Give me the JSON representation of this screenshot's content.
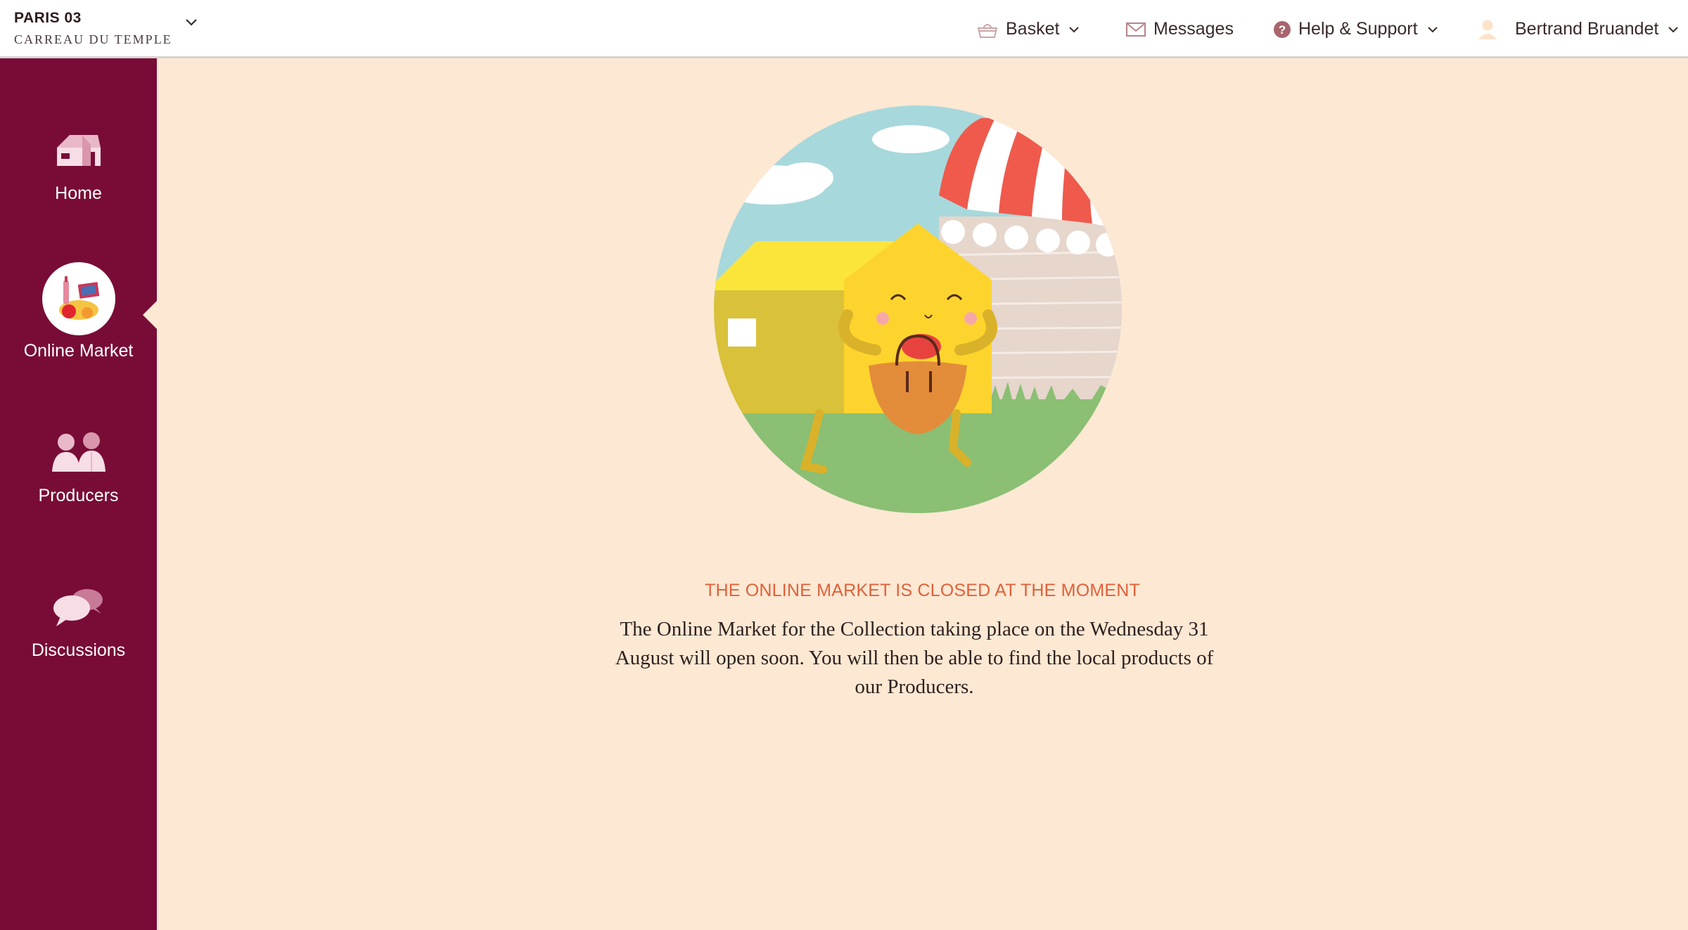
{
  "header": {
    "brand_city": "PARIS 03",
    "brand_sub": "CARREAU DU TEMPLE",
    "nav": {
      "basket": "Basket",
      "messages": "Messages",
      "help": "Help & Support",
      "user": "Bertrand Bruandet"
    }
  },
  "sidebar": {
    "items": [
      {
        "label": "Home",
        "icon": "house-icon"
      },
      {
        "label": "Online Market",
        "icon": "market-basket-icon",
        "active": true
      },
      {
        "label": "Producers",
        "icon": "producers-icon"
      },
      {
        "label": "Discussions",
        "icon": "chat-bubbles-icon"
      }
    ]
  },
  "main": {
    "closed_title": "THE ONLINE MARKET IS CLOSED AT THE MOMENT",
    "closed_message": "The Online Market for the Collection taking place on the Wednesday 31 August will open soon. You will then be able to find the local products of our Producers."
  },
  "colors": {
    "sidebar_bg": "#780c37",
    "page_bg": "#fde8d3",
    "accent_orange": "#e0613a",
    "header_bg": "#ffffff"
  }
}
